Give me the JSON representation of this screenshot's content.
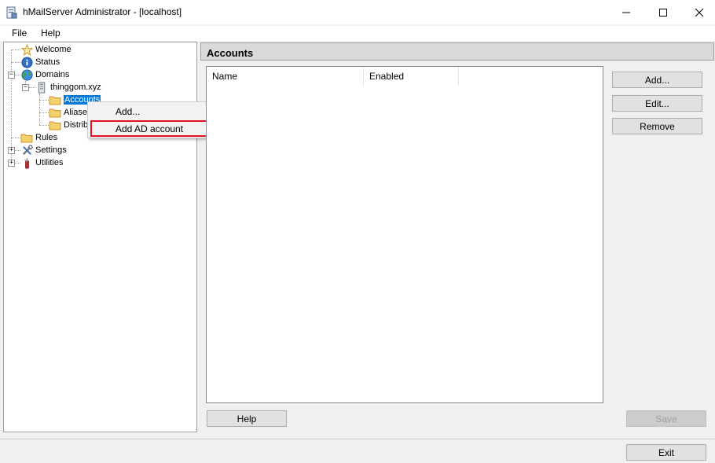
{
  "window": {
    "title": "hMailServer Administrator - [localhost]"
  },
  "menu": {
    "items": [
      "File",
      "Help"
    ]
  },
  "tree": {
    "welcome": "Welcome",
    "status": "Status",
    "domains": "Domains",
    "domain": "thinggom.xyz",
    "accounts": "Accounts",
    "aliases": "Aliase",
    "distribution": "Distrib",
    "rules": "Rules",
    "settings": "Settings",
    "utilities": "Utilities"
  },
  "context_menu": {
    "add": "Add...",
    "add_ad": "Add AD account"
  },
  "panel": {
    "title": "Accounts",
    "columns": [
      "Name",
      "Enabled"
    ]
  },
  "buttons": {
    "add": "Add...",
    "edit": "Edit...",
    "remove": "Remove",
    "help": "Help",
    "save": "Save",
    "exit": "Exit"
  }
}
